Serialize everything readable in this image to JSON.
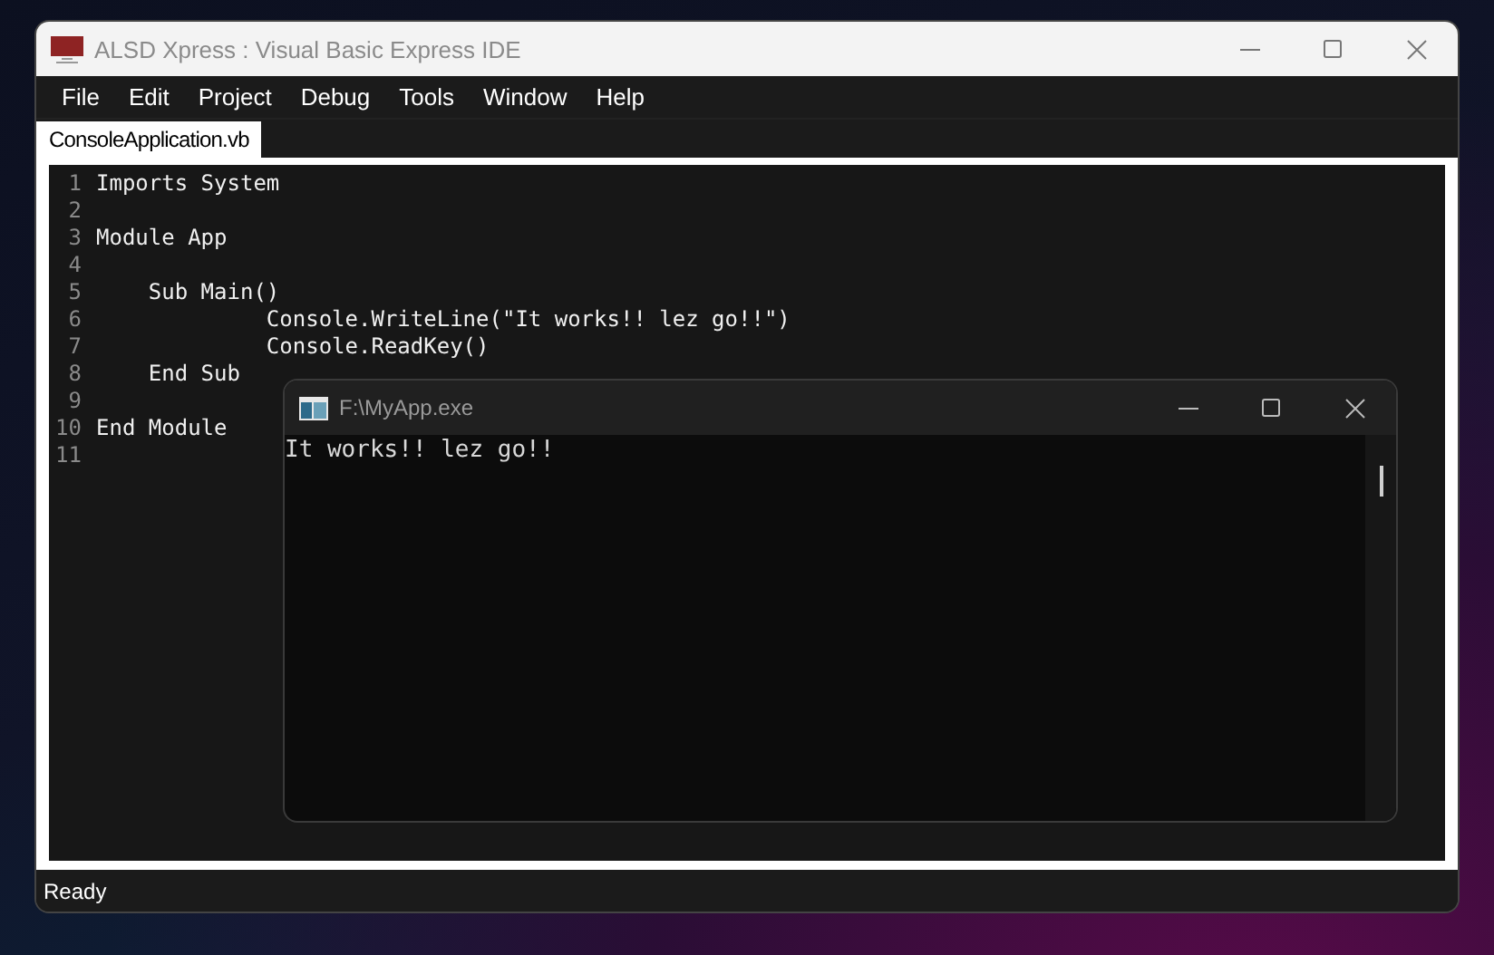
{
  "window": {
    "title": "ALSD Xpress : Visual Basic Express IDE"
  },
  "menu": [
    "File",
    "Edit",
    "Project",
    "Debug",
    "Tools",
    "Window",
    "Help"
  ],
  "tabs": [
    {
      "label": "ConsoleApplication.vb",
      "selected": true
    }
  ],
  "code_lines": [
    {
      "number": "1",
      "text": "Imports System"
    },
    {
      "number": "2"
    },
    {
      "number": "3",
      "text": "Module App"
    },
    {
      "number": "4"
    },
    {
      "number": "5",
      "text": "    Sub Main()"
    },
    {
      "number": "6",
      "text": "             Console.WriteLine(\"It works!! lez go!!\")"
    },
    {
      "number": "7",
      "text": "             Console.ReadKey()"
    },
    {
      "number": "8",
      "text": "    End Sub"
    },
    {
      "number": "9"
    },
    {
      "number": "10",
      "text": "End Module"
    },
    {
      "number": "11"
    }
  ],
  "console_window": {
    "title": "F:\\MyApp.exe",
    "output": [
      "It works!! lez go!!"
    ]
  },
  "status_bar": "Ready"
}
